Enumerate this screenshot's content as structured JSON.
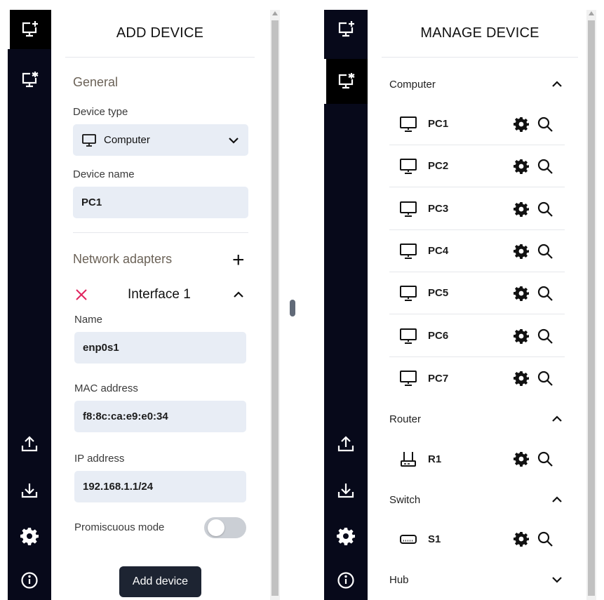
{
  "add_device": {
    "title": "ADD DEVICE",
    "general_heading": "General",
    "device_type_label": "Device type",
    "device_type_value": "Computer",
    "device_name_label": "Device name",
    "device_name_value": "PC1",
    "network_adapters_heading": "Network adapters",
    "interface": {
      "title": "Interface 1",
      "name_label": "Name",
      "name_value": "enp0s1",
      "mac_label": "MAC address",
      "mac_value": "f8:8c:ca:e9:e0:34",
      "ip_label": "IP address",
      "ip_value": "192.168.1.1/24",
      "promiscuous_label": "Promiscuous mode",
      "promiscuous_on": false
    },
    "submit_label": "Add device"
  },
  "manage_device": {
    "title": "MANAGE DEVICE",
    "categories": [
      {
        "label": "Computer",
        "expanded": true,
        "devices": [
          "PC1",
          "PC2",
          "PC3",
          "PC4",
          "PC5",
          "PC6",
          "PC7"
        ]
      },
      {
        "label": "Router",
        "expanded": true,
        "devices": [
          "R1"
        ]
      },
      {
        "label": "Switch",
        "expanded": true,
        "devices": [
          "S1"
        ]
      },
      {
        "label": "Hub",
        "expanded": false,
        "devices": []
      }
    ]
  },
  "sidebar": {
    "items": [
      "monitor-plus-icon",
      "monitor-star-icon",
      "upload-icon",
      "download-icon",
      "gear-icon",
      "info-icon"
    ]
  },
  "colors": {
    "sidebar_bg": "#07091a",
    "field_bg": "#e8edf5",
    "button_bg": "#1d2432",
    "remove_red": "#e0245e",
    "toggle_off": "#cbcfd5"
  }
}
